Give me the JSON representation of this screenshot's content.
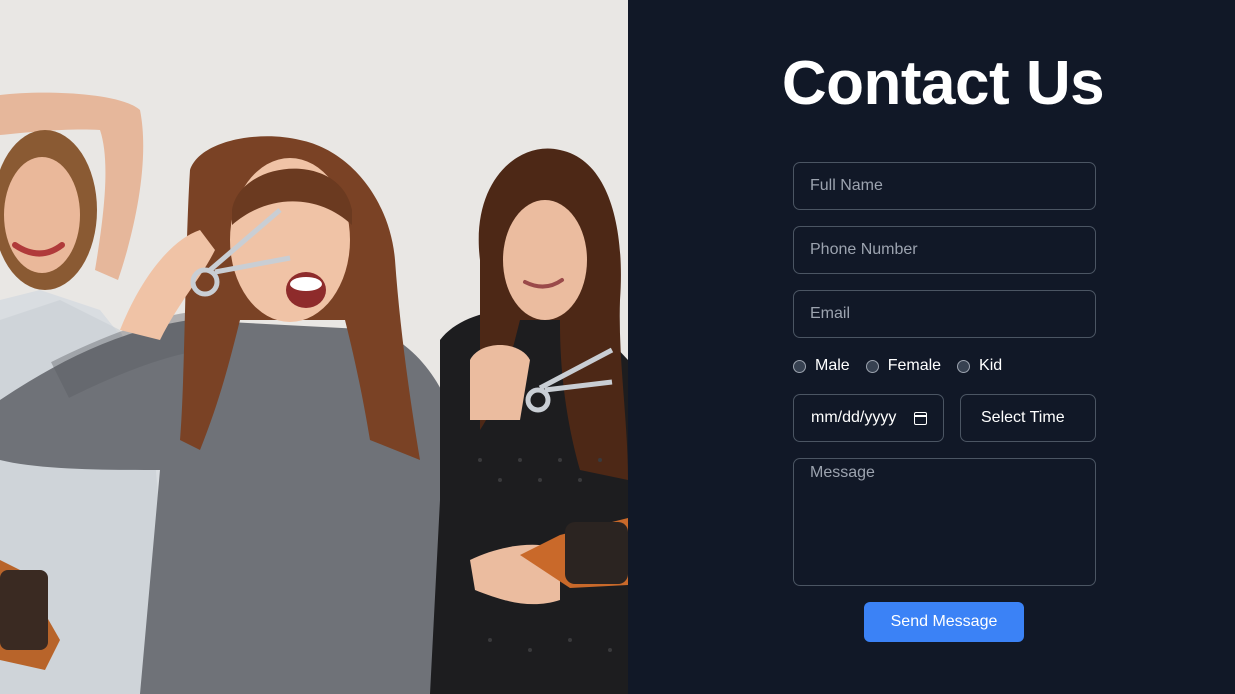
{
  "photo": {
    "alt": "Three smiling hairstylists holding scissors and hair brushes"
  },
  "contact": {
    "title": "Contact Us",
    "full_name_placeholder": "Full Name",
    "phone_placeholder": "Phone Number",
    "email_placeholder": "Email",
    "gender_options": [
      "Male",
      "Female",
      "Kid"
    ],
    "date_value": "mm/dd/yyyy",
    "time_value": "Select Time",
    "message_placeholder": "Message",
    "send_label": "Send Message"
  },
  "colors": {
    "panel_bg": "#111827",
    "field_border": "#4b5563",
    "button_bg": "#3b82f6",
    "title": "#ffffff"
  },
  "icons": [
    "calendar-icon"
  ]
}
